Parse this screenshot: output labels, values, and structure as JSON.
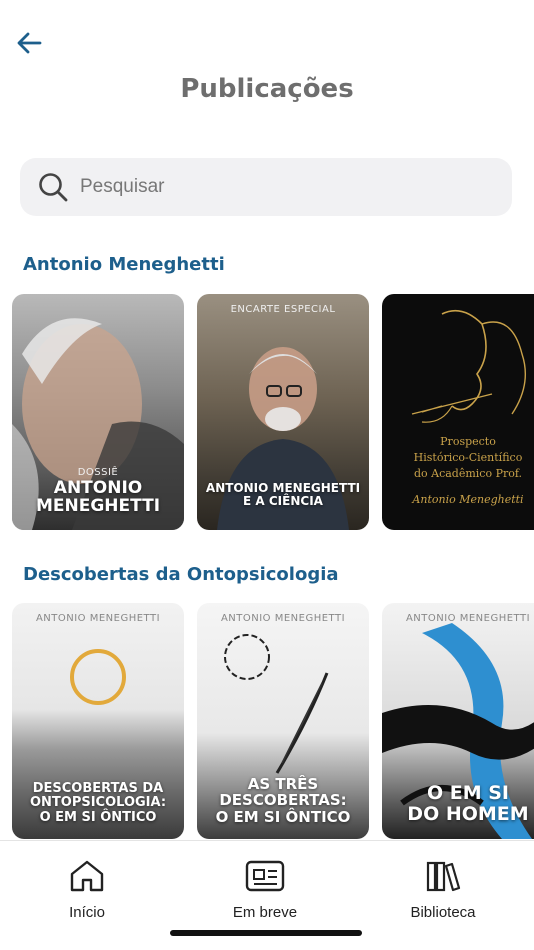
{
  "header": {
    "title": "Publicações"
  },
  "search": {
    "placeholder": "Pesquisar"
  },
  "sections": [
    {
      "title": "Antonio Meneghetti",
      "cards": [
        {
          "eyebrow": "DOSSIÊ",
          "title_line1": "ANTONIO",
          "title_line2": "MENEGHETTI"
        },
        {
          "eyebrow": "ENCARTE ESPECIAL",
          "title_line1": "ANTONIO MENEGHETTI",
          "title_line2": "E A CIÊNCIA"
        },
        {
          "title_line1": "Prospecto",
          "title_line2": "Histórico-Científico",
          "title_line3": "do Acadêmico Prof.",
          "signature": "Antonio Meneghetti"
        }
      ]
    },
    {
      "title": "Descobertas da Ontopsicologia",
      "cards": [
        {
          "eyebrow": "ANTONIO MENEGHETTI",
          "title_line1": "DESCOBERTAS DA",
          "title_line2": "ONTOPSICOLOGIA:",
          "title_line3": "O EM SI ÔNTICO"
        },
        {
          "eyebrow": "ANTONIO MENEGHETTI",
          "title_line1": "AS TRÊS",
          "title_line2": "DESCOBERTAS:",
          "title_line3": "O EM SI ÔNTICO"
        },
        {
          "eyebrow": "ANTONIO MENEGHETTI",
          "title_line1": "O EM SI",
          "title_line2": "DO HOMEM"
        }
      ]
    }
  ],
  "bottom_nav": {
    "items": [
      {
        "label": "Início",
        "icon": "home-icon"
      },
      {
        "label": "Em breve",
        "icon": "newspaper-icon"
      },
      {
        "label": "Biblioteca",
        "icon": "books-icon"
      }
    ]
  },
  "colors": {
    "accent": "#1d5f8c",
    "title_gray": "#6e6e6e",
    "search_bg": "#f1f1f3"
  }
}
